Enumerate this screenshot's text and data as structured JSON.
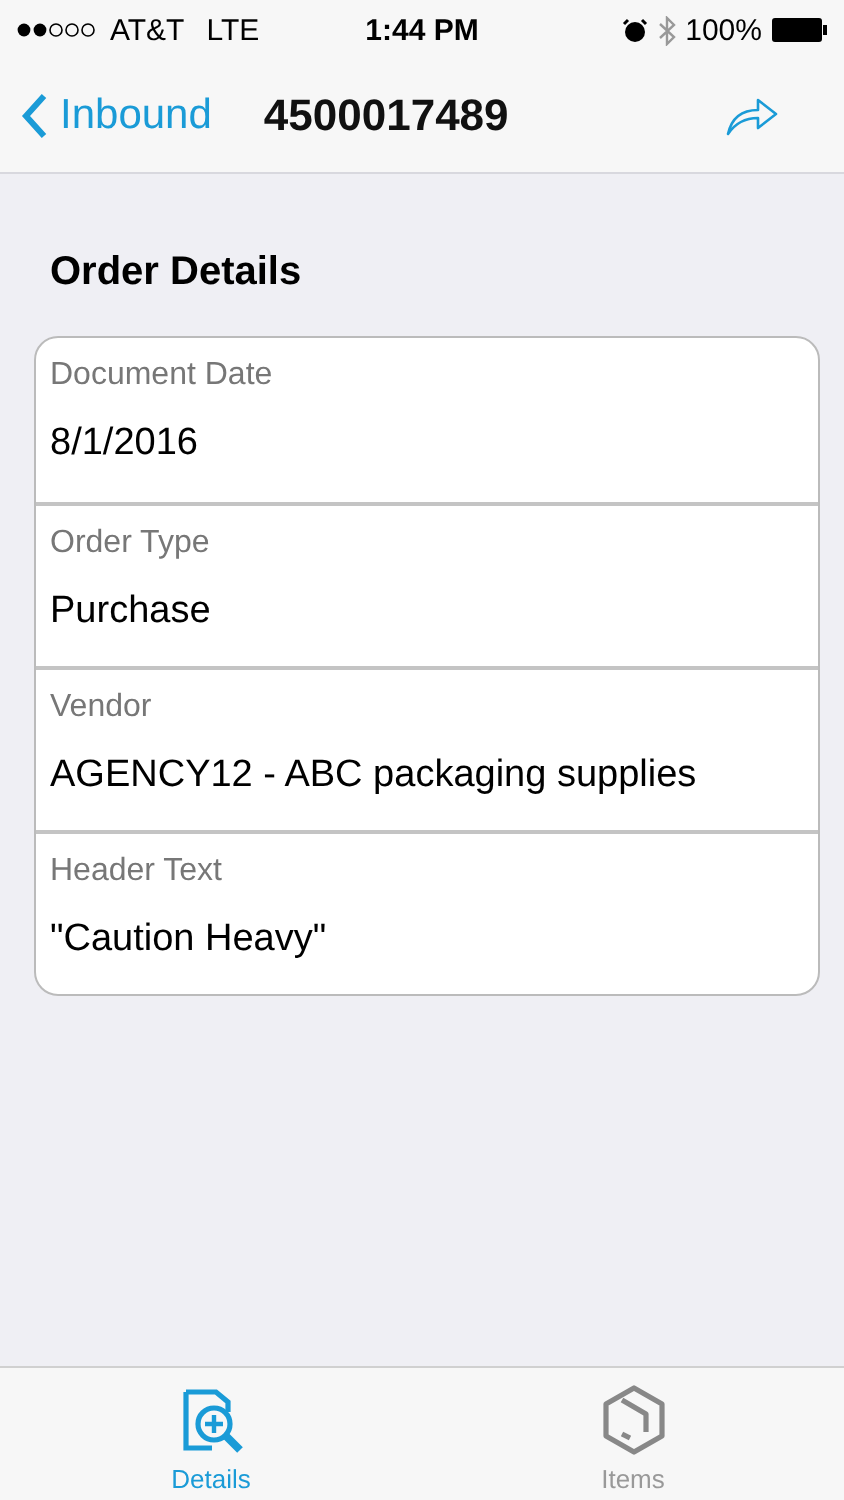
{
  "status_bar": {
    "carrier": "AT&T",
    "network": "LTE",
    "time": "1:44 PM",
    "battery": "100%"
  },
  "nav": {
    "back": "Inbound",
    "title": "4500017489"
  },
  "section_title": "Order Details",
  "fields": [
    {
      "label": "Document Date",
      "value": "8/1/2016"
    },
    {
      "label": "Order Type",
      "value": "Purchase"
    },
    {
      "label": "Vendor",
      "value": "AGENCY12 - ABC packaging supplies"
    },
    {
      "label": "Header Text",
      "value": "\"Caution Heavy\""
    }
  ],
  "tabs": [
    {
      "label": "Details",
      "kind": "details",
      "selected": true
    },
    {
      "label": "Items",
      "kind": "items",
      "selected": false
    }
  ]
}
